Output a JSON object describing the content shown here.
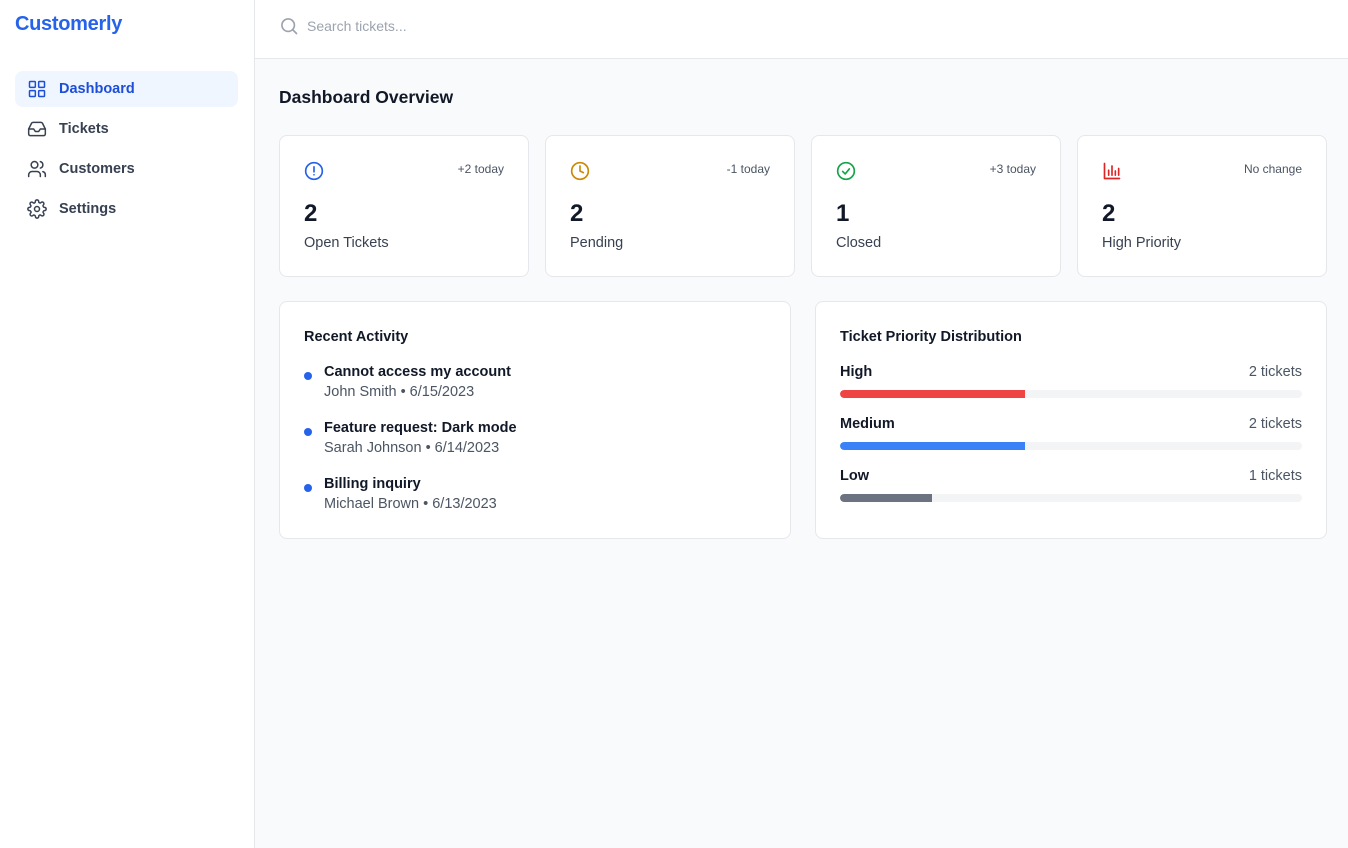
{
  "app": {
    "name": "Customerly"
  },
  "sidebar": {
    "items": [
      {
        "label": "Dashboard",
        "icon": "grid-icon",
        "active": true
      },
      {
        "label": "Tickets",
        "icon": "inbox-icon",
        "active": false
      },
      {
        "label": "Customers",
        "icon": "users-icon",
        "active": false
      },
      {
        "label": "Settings",
        "icon": "gear-icon",
        "active": false
      }
    ]
  },
  "search": {
    "placeholder": "Search tickets...",
    "value": ""
  },
  "page": {
    "title": "Dashboard Overview"
  },
  "stats": [
    {
      "value": "2",
      "label": "Open Tickets",
      "change": "+2 today",
      "icon": "alert-circle-icon",
      "color": "#2563eb"
    },
    {
      "value": "2",
      "label": "Pending",
      "change": "-1 today",
      "icon": "clock-icon",
      "color": "#ca8a04"
    },
    {
      "value": "1",
      "label": "Closed",
      "change": "+3 today",
      "icon": "check-circle-icon",
      "color": "#16a34a"
    },
    {
      "value": "2",
      "label": "High Priority",
      "change": "No change",
      "icon": "bar-chart-icon",
      "color": "#dc2626"
    }
  ],
  "recent_activity": {
    "title": "Recent Activity",
    "items": [
      {
        "title": "Cannot access my account",
        "meta": "John Smith • 6/15/2023"
      },
      {
        "title": "Feature request: Dark mode",
        "meta": "Sarah Johnson • 6/14/2023"
      },
      {
        "title": "Billing inquiry",
        "meta": "Michael Brown • 6/13/2023"
      }
    ]
  },
  "priority_distribution": {
    "title": "Ticket Priority Distribution",
    "rows": [
      {
        "label": "High",
        "count": "2 tickets",
        "fraction": 0.4,
        "color": "#ef4444"
      },
      {
        "label": "Medium",
        "count": "2 tickets",
        "fraction": 0.4,
        "color": "#3b82f6"
      },
      {
        "label": "Low",
        "count": "1 tickets",
        "fraction": 0.2,
        "color": "#6b7280"
      }
    ]
  }
}
